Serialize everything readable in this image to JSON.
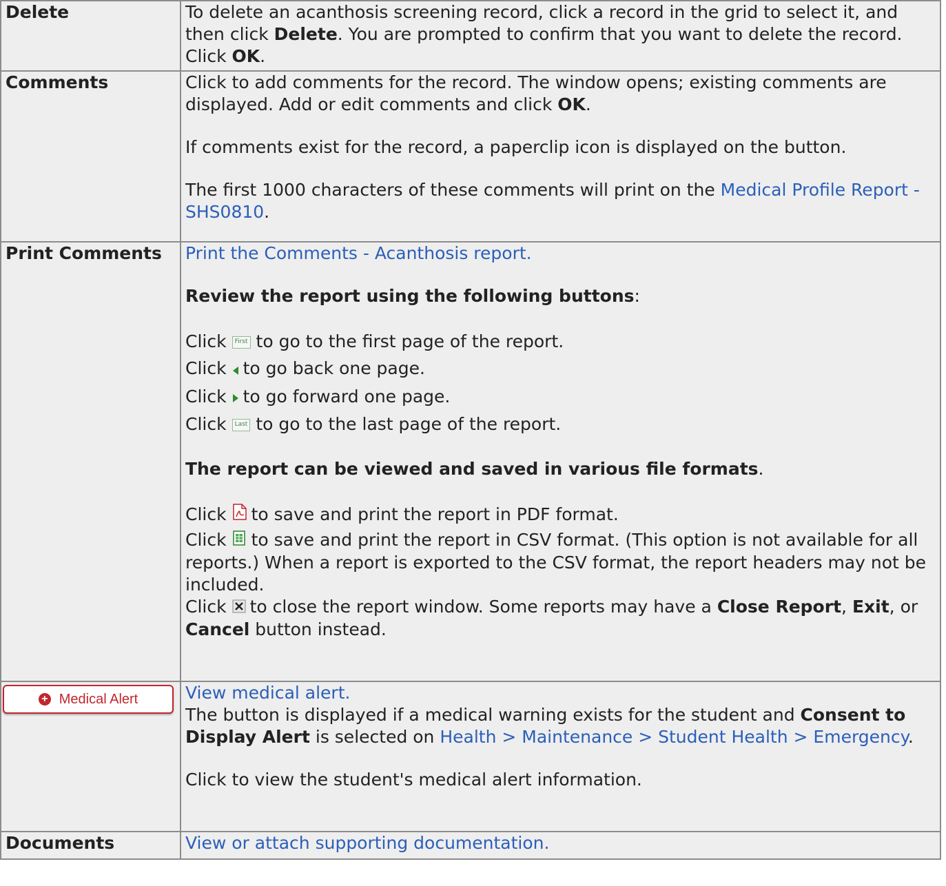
{
  "rows": {
    "delete": {
      "label": "Delete",
      "text1": "To delete an acanthosis screening record, click a record in the grid to select it, and then click ",
      "bold1": "Delete",
      "text2": ". You are prompted to confirm that you want to delete the record. Click ",
      "bold2": "OK",
      "text3": "."
    },
    "comments": {
      "label": "Comments",
      "p1_text": "Click to add comments for the record. The window opens; existing comments are displayed. Add or edit comments and click ",
      "p1_bold": "OK",
      "p1_end": ".",
      "p2": "If comments exist for the record, a paperclip icon is displayed on the button.",
      "p3_text": "The first 1000 characters of these comments will print on the ",
      "p3_link": "Medical Profile Report - SHS0810",
      "p3_end": "."
    },
    "print_comments": {
      "label": "Print Comments",
      "link": "Print the Comments - Acanthosis report.",
      "review_heading": "Review the report using the following buttons",
      "review_colon": ":",
      "click_word": "Click",
      "first_btn": "First",
      "first_text": "to go to the first page of the report.",
      "back_text": "to go back one page.",
      "fwd_text": "to go forward one page.",
      "last_btn": "Last",
      "last_text": "to go to the last page of the report.",
      "formats_heading": "The report can be viewed and saved in various file formats",
      "formats_period": ".",
      "pdf_text": "to save and print the report in PDF format.",
      "csv_text": "to save and print the report in CSV format. (This option is not available for all reports.) When a report is exported to the CSV format, the report headers may not be included.",
      "close_text1": "to close the report window. Some reports may have a ",
      "close_bold1": "Close Report",
      "close_text2": ", ",
      "close_bold2": "Exit",
      "close_text3": ", or ",
      "close_bold3": "Cancel",
      "close_text4": " button instead."
    },
    "medical_alert": {
      "button_label": "Medical Alert",
      "link": "View medical alert.",
      "text1": "The button is displayed if a medical warning exists for the student and ",
      "bold1": "Consent to Display Alert",
      "text2": " is selected on ",
      "link2": "Health > Maintenance > Student Health > Emergency",
      "text3": ".",
      "p2": "Click to view the student's medical alert information."
    },
    "documents": {
      "label": "Documents",
      "link": "View or attach supporting documentation."
    }
  },
  "icons": {
    "back": "triangle-left-icon",
    "forward": "triangle-right-icon",
    "pdf": "pdf-icon",
    "csv": "csv-icon",
    "close": "close-x-icon",
    "medical": "plus-circle-icon"
  },
  "colors": {
    "link": "#2b5fb8",
    "cell_bg": "#eeeeee",
    "border": "#8c8c8c",
    "alert_red": "#c0262d"
  }
}
